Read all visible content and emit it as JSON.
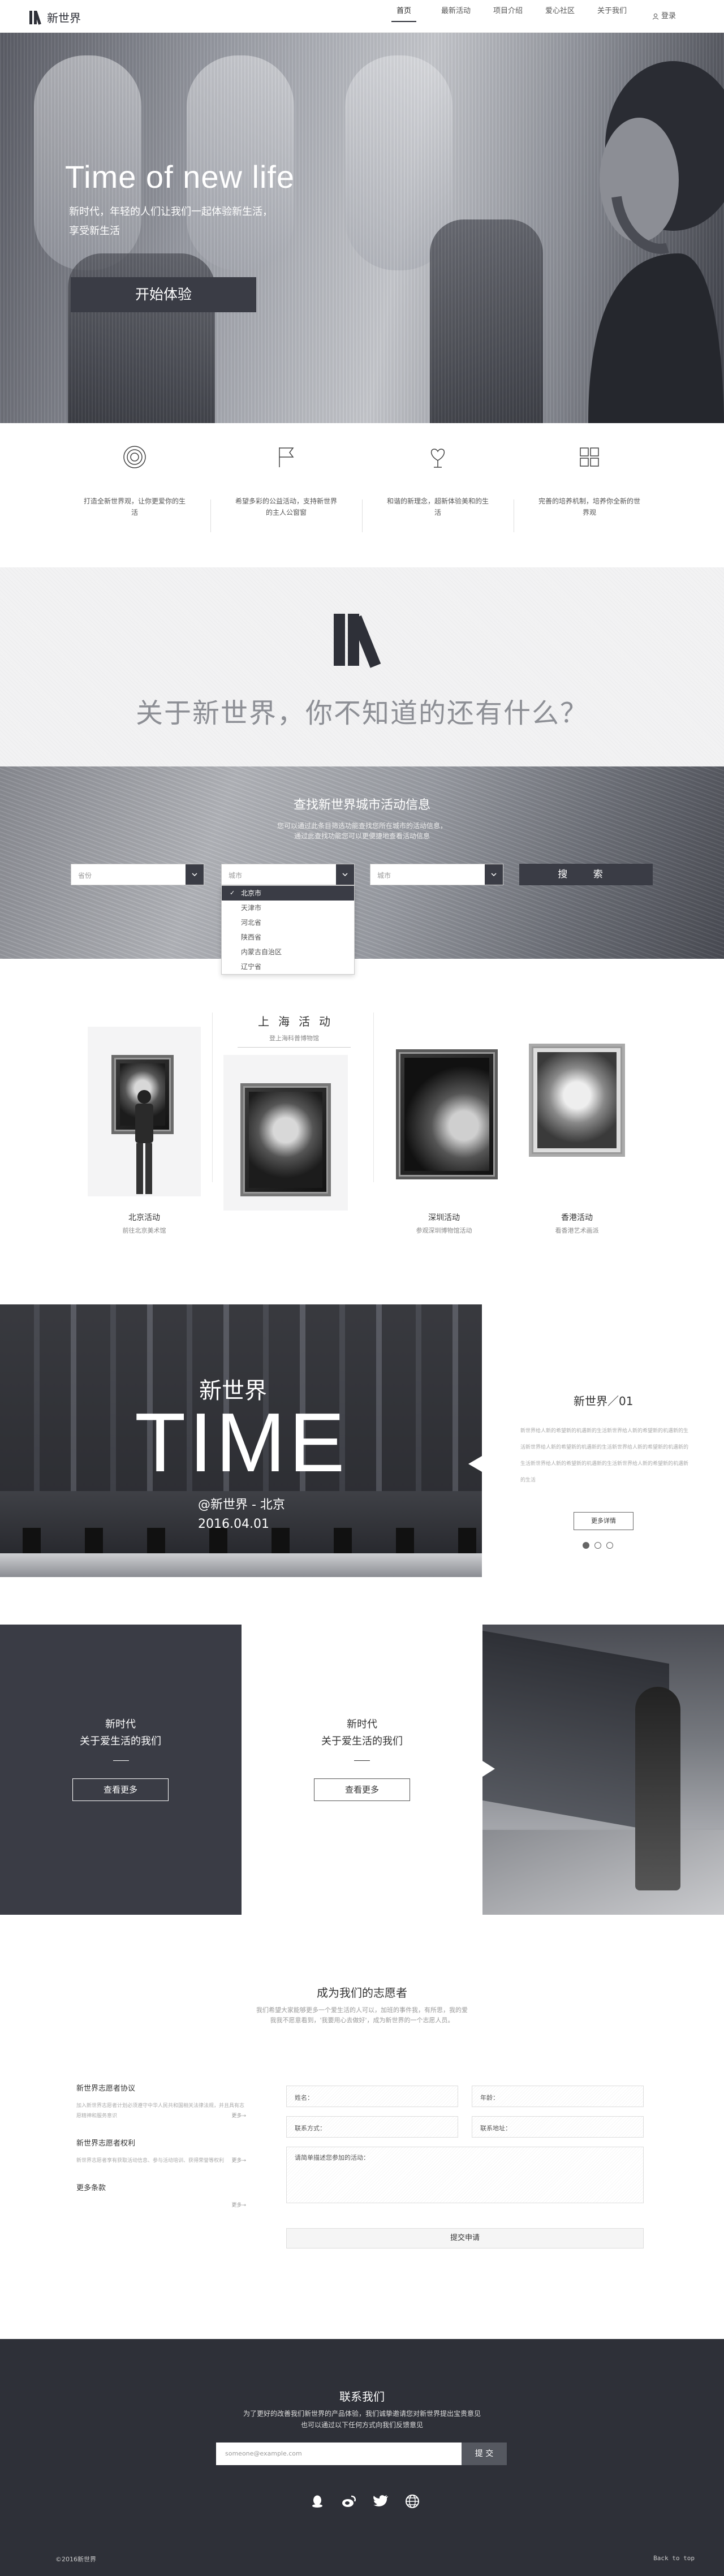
{
  "brand": {
    "name": "新世界"
  },
  "nav": {
    "items": [
      {
        "label": "首页"
      },
      {
        "label": "最新活动"
      },
      {
        "label": "项目介绍"
      },
      {
        "label": "爱心社区"
      },
      {
        "label": "关于我们"
      }
    ],
    "login": "登录"
  },
  "hero": {
    "title": "Time of new life",
    "subtitle": "新时代，年轻的人们让我们一起体验新生活，享受新生活",
    "button": "开始体验"
  },
  "features": [
    {
      "icon": "target-icon",
      "text": "打造全新世界观，让你更爱你的生活"
    },
    {
      "icon": "flag-icon",
      "text": "希望多彩的公益活动，支持新世界的主人公窗窗"
    },
    {
      "icon": "heart-plant-icon",
      "text": "和谐的新理念，超新体验美和的生活"
    },
    {
      "icon": "grid-icon",
      "text": "完善的培养机制，培养你全新的世界观"
    }
  ],
  "about": {
    "title": "关于新世界，你不知道的还有什么？"
  },
  "search": {
    "title": "查找新世界城市活动信息",
    "desc_line1": "您可以通过此条目筛选功能查找您所在城市的活动信息，",
    "desc_line2": "通过此查找功能您可以更便捷地查看活动信息",
    "select1": "省份",
    "select2": "城市",
    "select3": "城市",
    "button": "搜 索",
    "dropdown": [
      "北京市",
      "天津市",
      "河北省",
      "陕西省",
      "内蒙古自治区",
      "辽宁省"
    ],
    "dropdown_selected": 0
  },
  "events": {
    "shanghai": {
      "title": "上海活动",
      "sub": "登上海科普博物馆"
    },
    "cards": [
      {
        "title": "北京活动",
        "sub": "前往北京美术馆"
      },
      {
        "title": "深圳活动",
        "sub": "参观深圳博物馆活动"
      },
      {
        "title": "香港活动",
        "sub": "看香港艺术画派"
      }
    ]
  },
  "time": {
    "name": "新世界",
    "big": "TIME",
    "location": "@新世界 - 北京",
    "date": "2016.04.01",
    "card_title": "新世界／01",
    "card_text": "新世界给人新的希望新的机遇新的生活新世界给人新的希望新的机遇新的生活新世界给人新的希望新的机遇新的生活新世界给人新的希望新的机遇新的生活新世界给人新的希望新的机遇新的生活新世界给人新的希望新的机遇新的生活",
    "more": "更多详情",
    "slides": [
      true,
      false,
      false
    ]
  },
  "era": {
    "dark": {
      "line1": "新时代",
      "line2": "关于爱生活的我们",
      "button": "查看更多"
    },
    "light": {
      "line1": "新时代",
      "line2": "关于爱生活的我们",
      "button": "查看更多"
    }
  },
  "volunteer": {
    "title": "成为我们的志愿者",
    "desc_line1": "我们希望大家能够更多一个爱生活的人可以，加班的事件我，有所思，我的爱",
    "desc_line2": "我我不愿意看到，'我要用心去做好'，成为新世界的一个志愿人员。",
    "items": [
      {
        "title": "新世界志愿者协议",
        "text": "加入新世界志愿者计划必须遵守中华人民共和国相关法律法规，并且具有志愿精神和服务意识",
        "more": "更多→"
      },
      {
        "title": "新世界志愿者权利",
        "text": "新世界志愿者享有获取活动信息、参与活动培训、获得荣誉等权利",
        "more": "更多→"
      },
      {
        "title": "更多条款",
        "text": "",
        "more": "更多→"
      }
    ],
    "form": {
      "name": "姓名：",
      "age": "年龄：",
      "contact": "联系方式：",
      "address": "联系地址：",
      "message": "请简单描述您参加的活动：",
      "submit": "提交申请"
    }
  },
  "contact": {
    "title": "联系我们",
    "desc_line1": "为了更好的改善我们新世界的产品体验，我们诚挚邀请您对新世界提出宝贵意见",
    "desc_line2": "也可以通过以下任何方式向我们反馈意见",
    "placeholder": "someone@example.com",
    "button": "提 交",
    "icons": [
      "qq-icon",
      "weibo-icon",
      "twitter-icon",
      "globe-icon"
    ],
    "copyright": "©2016新世界",
    "back_to_top": "Back to top"
  }
}
